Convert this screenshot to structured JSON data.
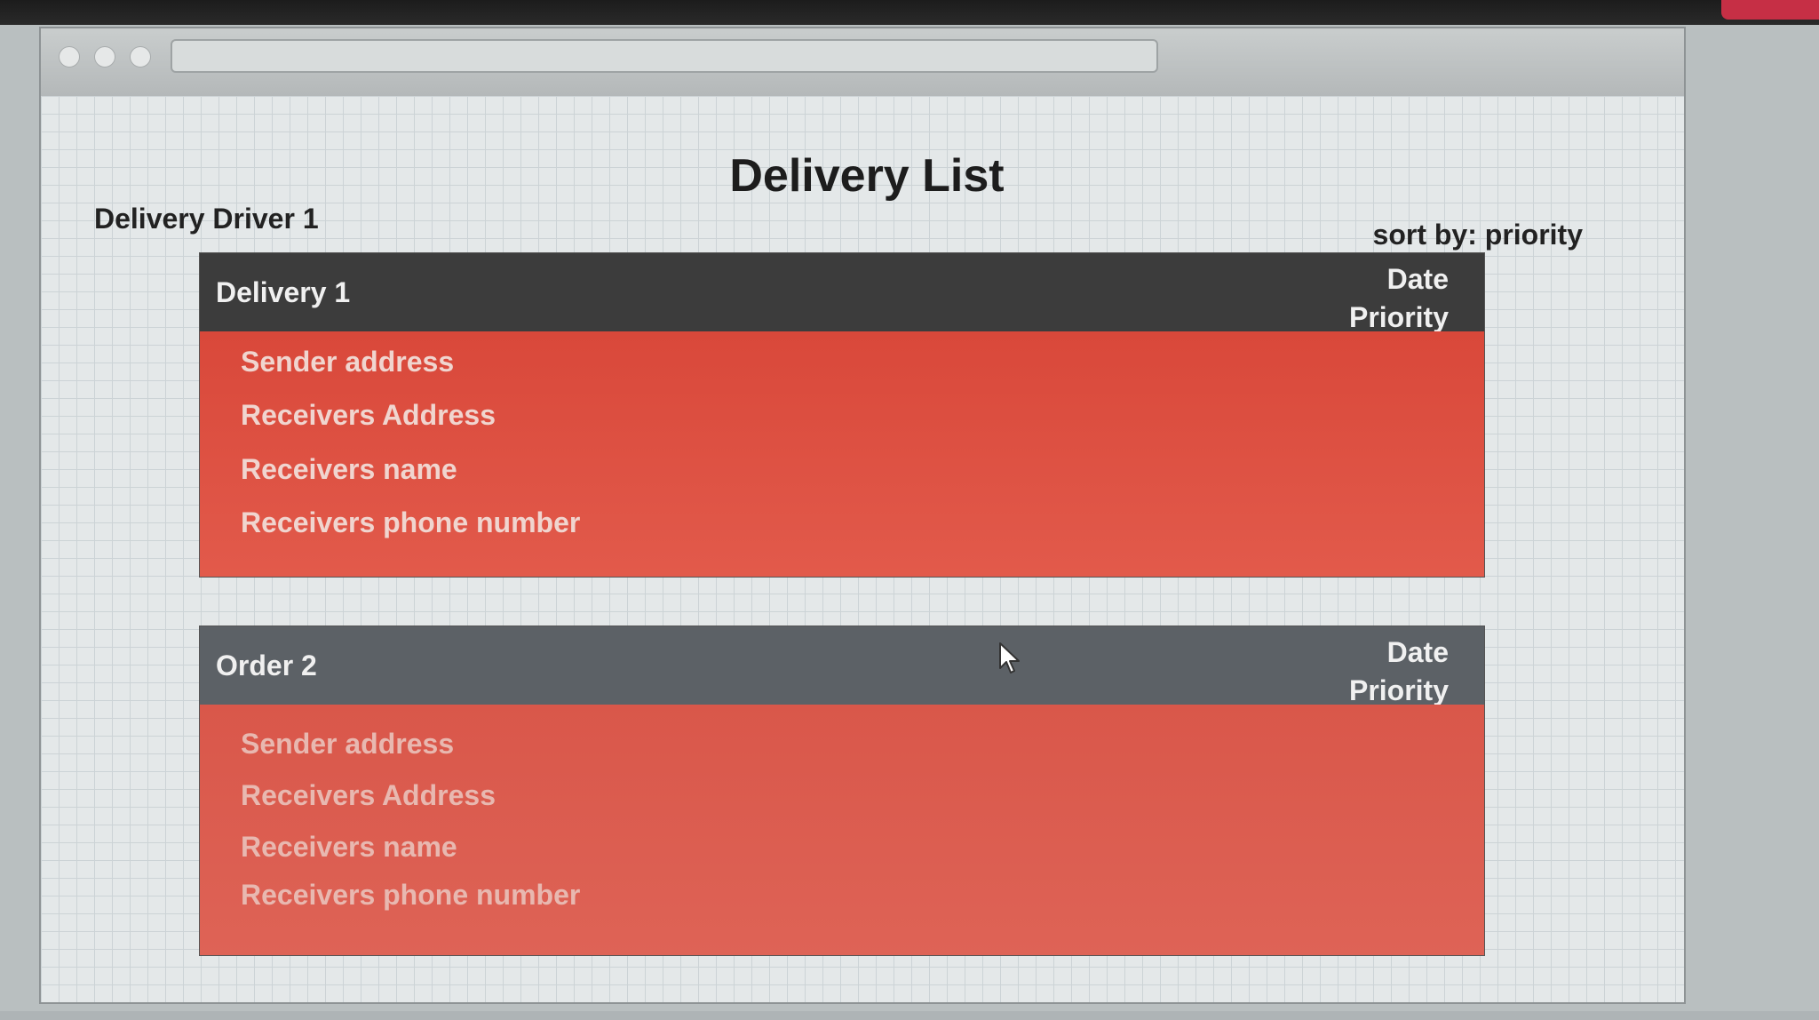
{
  "page": {
    "title": "Delivery List",
    "driver": "Delivery Driver 1",
    "sort": "sort by: priority"
  },
  "deliveries": [
    {
      "name": "Delivery 1",
      "date_label": "Date",
      "priority_label": "Priority",
      "fields": [
        "Sender address",
        "Receivers Address",
        "Receivers name",
        "Receivers phone number"
      ]
    },
    {
      "name": "Order 2",
      "date_label": "Date",
      "priority_label": "Priority",
      "fields": [
        "Sender address",
        "Receivers Address",
        "Receivers name",
        "Receivers phone number"
      ]
    }
  ],
  "colors": {
    "header_dark": "#3c3c3c",
    "header_grey": "#5c6166",
    "card_red": "#d9483a",
    "grid": "#ccd3d6"
  },
  "icons": {
    "window_controls": [
      "window-dot-icon",
      "window-dot-icon",
      "window-dot-icon"
    ],
    "cursor": "mouse-cursor-icon"
  }
}
